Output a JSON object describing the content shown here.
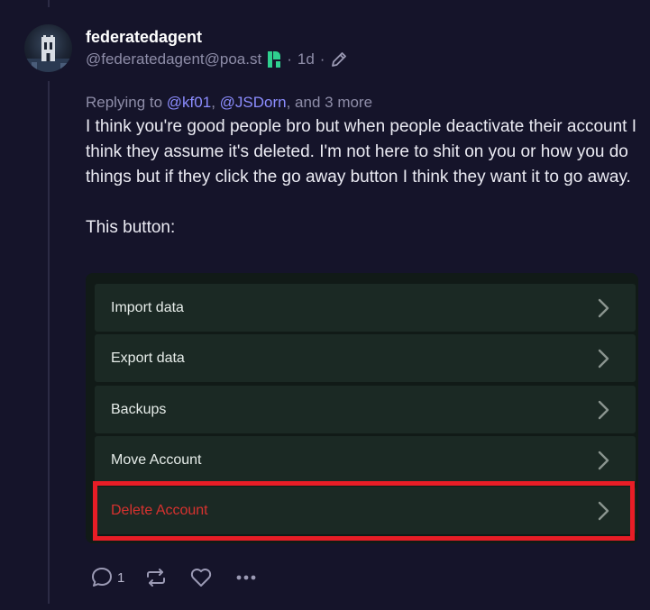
{
  "post": {
    "display_name": "federatedagent",
    "handle": "@federatedagent@poa.st",
    "separator": "·",
    "time": "1d",
    "replying_prefix": "Replying to",
    "mention_1": "@kf01",
    "comma": ",",
    "mention_2": "@JSDorn",
    "replying_suffix": ", and 3 more",
    "paragraph_1": "I think you're good people bro but when people deactivate their account I think they assume it's deleted. I'm not here to shit on you or how you do things but if they click the go away button I think they want it to go away.",
    "paragraph_2": "This button:"
  },
  "embed_menu": {
    "items": [
      {
        "label": "Import data"
      },
      {
        "label": "Export data"
      },
      {
        "label": "Backups"
      },
      {
        "label": "Move Account"
      },
      {
        "label": "Delete Account"
      }
    ]
  },
  "actions": {
    "reply_count": "1"
  },
  "colors": {
    "background": "#15142a",
    "mention": "#8c8dff",
    "danger_text": "#d8322f",
    "highlight_border": "#e81d26",
    "pleroma_badge": "#2fd08f"
  },
  "icons": {
    "badge": "pleroma-logo-icon",
    "edit": "pencil-icon",
    "chevron": "chevron-right-icon",
    "reply": "speech-bubble-icon",
    "repost": "repost-icon",
    "like": "heart-icon",
    "more": "more-dots-icon"
  }
}
